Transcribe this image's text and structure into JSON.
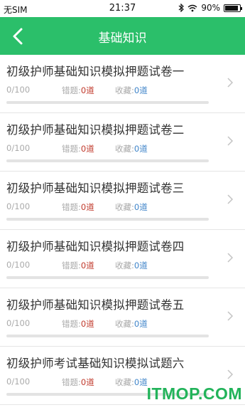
{
  "status_bar": {
    "carrier": "无SIM",
    "time": "21:37",
    "battery": "90%"
  },
  "header": {
    "title": "基础知识"
  },
  "items": [
    {
      "title": "初级护师基础知识模拟押题试卷一",
      "progress": "0/100",
      "wrong_label": "错题:",
      "wrong_count": "0道",
      "fav_label": "收藏:",
      "fav_count": "0道"
    },
    {
      "title": "初级护师基础知识模拟押题试卷二",
      "progress": "0/100",
      "wrong_label": "错题:",
      "wrong_count": "0道",
      "fav_label": "收藏:",
      "fav_count": "0道"
    },
    {
      "title": "初级护师基础知识模拟押题试卷三",
      "progress": "0/100",
      "wrong_label": "错题:",
      "wrong_count": "0道",
      "fav_label": "收藏:",
      "fav_count": "0道"
    },
    {
      "title": "初级护师基础知识模拟押题试卷四",
      "progress": "0/100",
      "wrong_label": "错题:",
      "wrong_count": "0道",
      "fav_label": "收藏:",
      "fav_count": "0道"
    },
    {
      "title": "初级护师基础知识模拟押题试卷五",
      "progress": "0/100",
      "wrong_label": "错题:",
      "wrong_count": "0道",
      "fav_label": "收藏:",
      "fav_count": "0道"
    },
    {
      "title": "初级护师考试基础知识模拟试题六",
      "progress": "0/100",
      "wrong_label": "错题:",
      "wrong_count": "0道",
      "fav_label": "收藏:",
      "fav_count": "0道"
    }
  ],
  "watermark": "ITMOP.COM",
  "colors": {
    "header": "#2bbf6a",
    "wrong": "#c0392b",
    "fav": "#3f84c9"
  }
}
